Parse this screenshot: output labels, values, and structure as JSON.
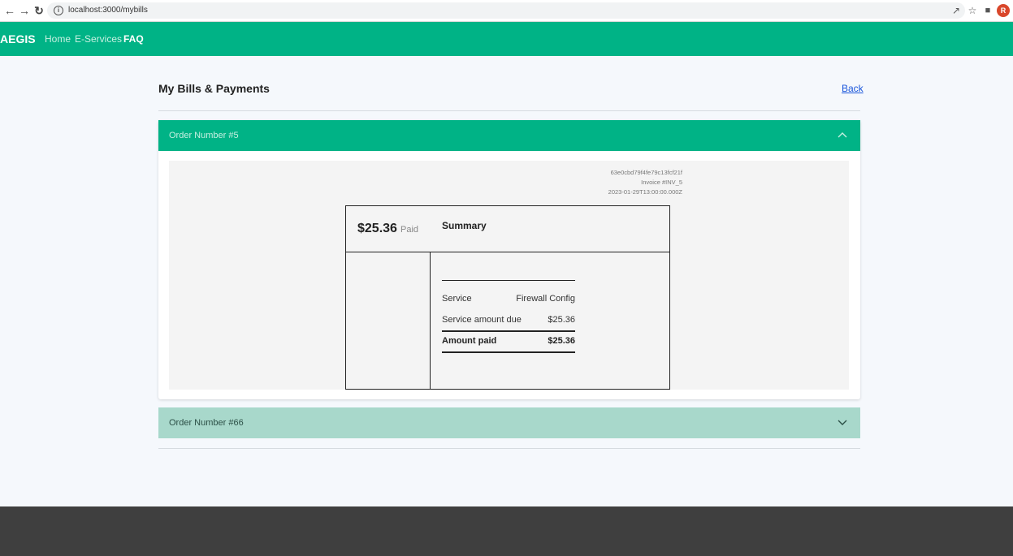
{
  "browser": {
    "url": "localhost:3000/mybills",
    "back_icon": "arrow-left-icon",
    "forward_icon": "arrow-right-icon",
    "reload_icon": "reload-icon",
    "profile_initial": "R"
  },
  "nav": {
    "brand": "AEGIS",
    "links": [
      "Home",
      "E-Services",
      "FAQ"
    ]
  },
  "page": {
    "title": "My Bills & Payments",
    "back": "Back"
  },
  "orders": [
    {
      "title": "Order Number #5",
      "expanded": true,
      "invoice": {
        "id": "63e0cbd79f4fe79c13fcf21f",
        "number": "Invoice #INV_5",
        "date": "2023-01-29T13:00:00.000Z",
        "amount": "$25.36",
        "status": "Paid",
        "summary_title": "Summary",
        "rows": [
          {
            "label": "Service",
            "value": "Firewall Config"
          },
          {
            "label": "Service amount due",
            "value": "$25.36"
          },
          {
            "label": "Amount paid",
            "value": "$25.36"
          }
        ]
      }
    },
    {
      "title": "Order Number #66",
      "expanded": false
    }
  ],
  "colors": {
    "brand": "#00b386",
    "collapsed_header": "#a8d8cb",
    "footer": "#3f3f3f"
  }
}
